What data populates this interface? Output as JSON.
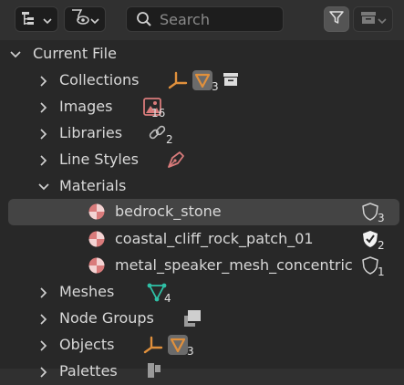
{
  "search": {
    "placeholder": "Search",
    "value": ""
  },
  "tree": {
    "root_label": "Current File",
    "collections": {
      "label": "Collections",
      "count": "3"
    },
    "images": {
      "label": "Images",
      "count": "16"
    },
    "libraries": {
      "label": "Libraries",
      "count": "2"
    },
    "line_styles": {
      "label": "Line Styles"
    },
    "materials": {
      "label": "Materials",
      "items": [
        {
          "label": "bedrock_stone",
          "count": "3"
        },
        {
          "label": "coastal_cliff_rock_patch_01",
          "count": "2"
        },
        {
          "label": "metal_speaker_mesh_concentric",
          "count": "1"
        }
      ]
    },
    "meshes": {
      "label": "Meshes",
      "count": "4"
    },
    "node_groups": {
      "label": "Node Groups"
    },
    "objects": {
      "label": "Objects",
      "count": "3"
    },
    "palettes": {
      "label": "Palettes"
    }
  },
  "colors": {
    "material": "#d97b7b",
    "object": "#e0903c",
    "mesh": "#2fc0a6",
    "selected_row": "#444444",
    "background": "#282828"
  },
  "icons": {
    "display_mode": "outliner-display-mode-icon",
    "view_options": "view-filter-eye-icon",
    "search": "search-icon",
    "filter": "funnel-filter-icon",
    "new_collection": "collection-box-icon"
  }
}
